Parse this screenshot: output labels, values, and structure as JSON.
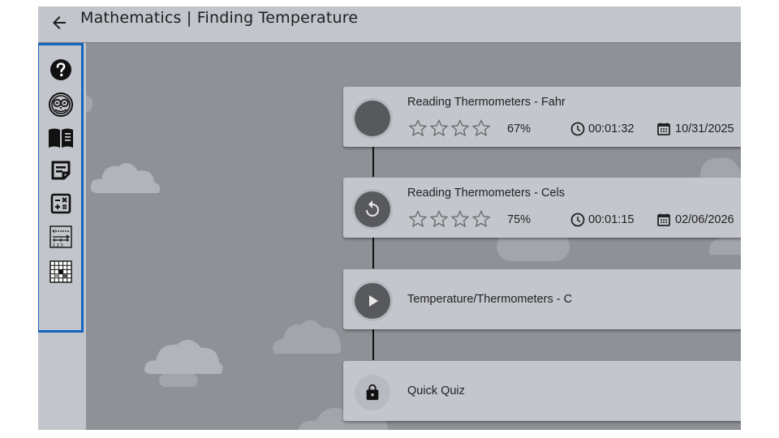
{
  "header": {
    "back_icon": "arrow-left-icon",
    "title": "Mathematics | Finding Temperature"
  },
  "sidebar": {
    "tools": [
      {
        "name": "help-icon"
      },
      {
        "name": "owl-icon"
      },
      {
        "name": "book-icon"
      },
      {
        "name": "notes-icon"
      },
      {
        "name": "calculator-icon"
      },
      {
        "name": "number-line-icon"
      },
      {
        "name": "grid-icon"
      }
    ],
    "accent": "#1565c0"
  },
  "lessons": [
    {
      "title": "Reading Thermometers - Fahr",
      "status_icon": "in-progress-dot",
      "stars_filled": 0,
      "stars_total": 4,
      "score": "67%",
      "time": "00:01:32",
      "date": "10/31/2025"
    },
    {
      "title": "Reading Thermometers - Cels",
      "status_icon": "replay-icon",
      "stars_filled": 0,
      "stars_total": 4,
      "score": "75%",
      "time": "00:01:15",
      "date": "02/06/2026"
    },
    {
      "title": "Temperature/Thermometers - C",
      "status_icon": "play-icon"
    },
    {
      "title": "Quick Quiz",
      "status_icon": "lock-icon"
    }
  ],
  "colors": {
    "background": "#8e9196",
    "card": "#c4c6cd",
    "header": "#c3c5cc",
    "status_dark": "#58595c"
  }
}
